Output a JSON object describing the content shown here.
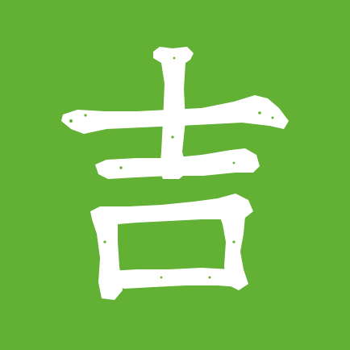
{
  "icon": {
    "glyph": "吉",
    "background_color": "#62B034",
    "glyph_color": "#FFFFFF",
    "style": "brush-stroke logo"
  }
}
